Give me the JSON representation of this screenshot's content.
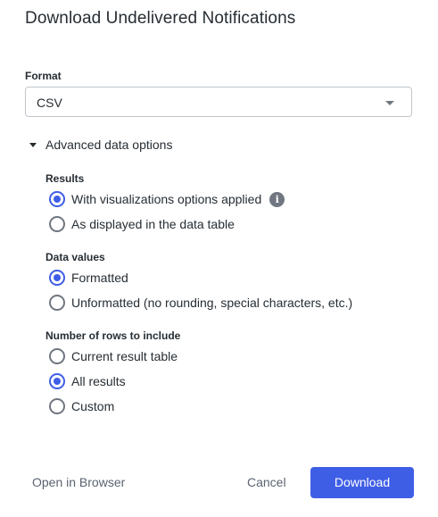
{
  "dialog": {
    "title": "Download Undelivered Notifications"
  },
  "format": {
    "label": "Format",
    "selected": "CSV"
  },
  "advanced": {
    "toggle_label": "Advanced data options",
    "results": {
      "label": "Results",
      "options": [
        {
          "label": "With visualizations options applied",
          "checked": true,
          "info_icon": "info-icon"
        },
        {
          "label": "As displayed in the data table",
          "checked": false
        }
      ]
    },
    "data_values": {
      "label": "Data values",
      "options": [
        {
          "label": "Formatted",
          "checked": true
        },
        {
          "label": "Unformatted (no rounding, special characters, etc.)",
          "checked": false
        }
      ]
    },
    "rows": {
      "label": "Number of rows to include",
      "options": [
        {
          "label": "Current result table",
          "checked": false
        },
        {
          "label": "All results",
          "checked": true
        },
        {
          "label": "Custom",
          "checked": false
        }
      ]
    }
  },
  "footer": {
    "open_label": "Open in Browser",
    "cancel_label": "Cancel",
    "download_label": "Download"
  },
  "colors": {
    "accent": "#3f5ee6",
    "text": "#262d33",
    "muted": "#707781"
  }
}
